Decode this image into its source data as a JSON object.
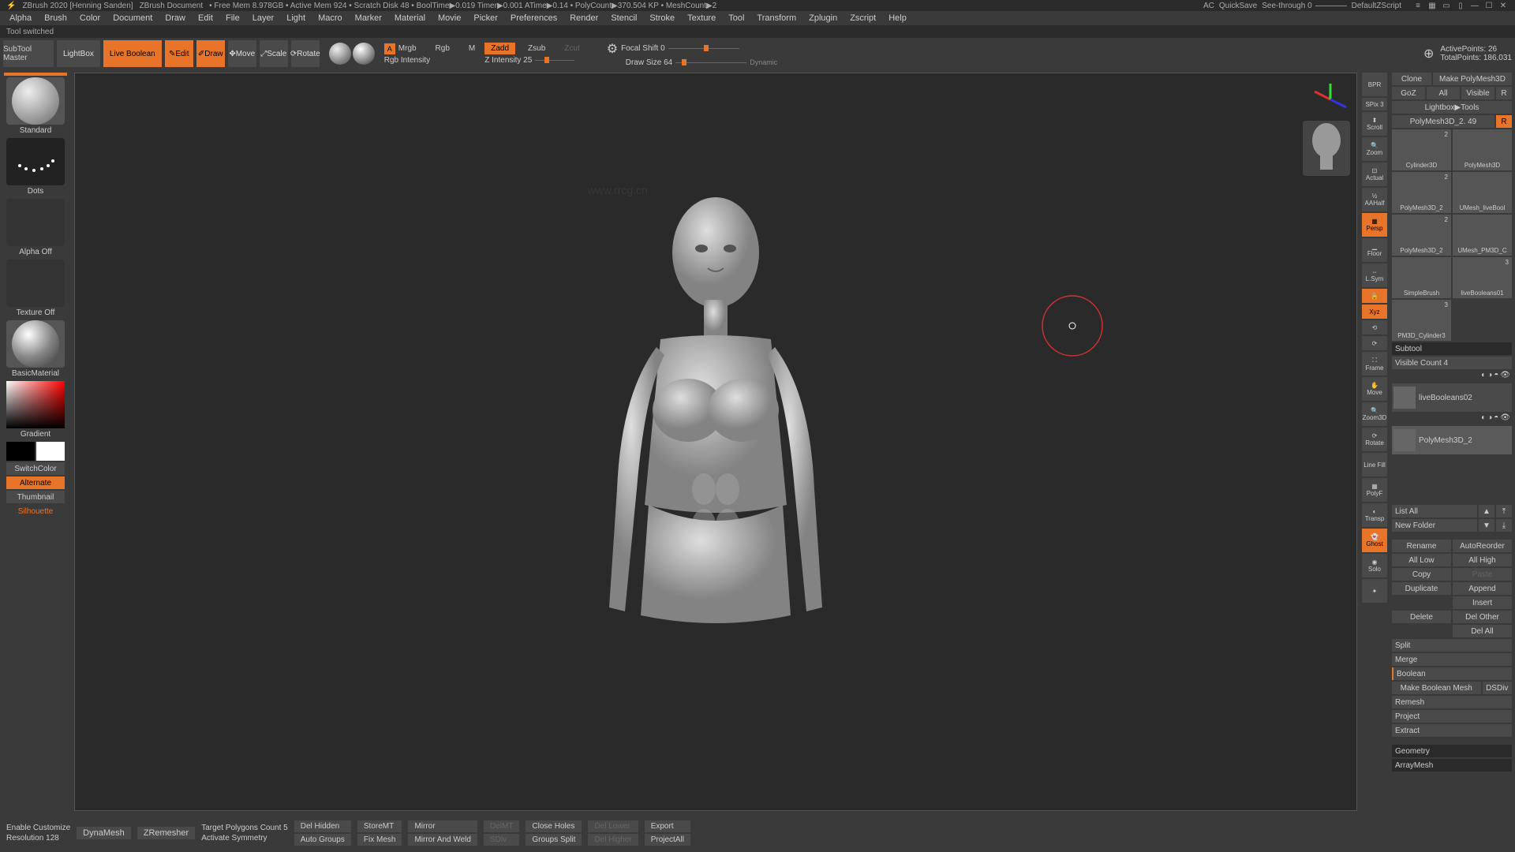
{
  "titlebar": {
    "app": "ZBrush 2020 [Henning Sanden]",
    "doc": "ZBrush Document",
    "stats": "• Free Mem 8.978GB • Active Mem 924 • Scratch Disk 48 • BoolTime▶0.019 Timer▶0.001 ATime▶0.14 • PolyCount▶370.504 KP • MeshCount▶2",
    "ac": "AC",
    "quicksave": "QuickSave",
    "seethrough": "See-through  0",
    "defaultscript": "DefaultZScript"
  },
  "menubar": [
    "Alpha",
    "Brush",
    "Color",
    "Document",
    "Draw",
    "Edit",
    "File",
    "Layer",
    "Light",
    "Macro",
    "Marker",
    "Material",
    "Movie",
    "Picker",
    "Preferences",
    "Render",
    "Stencil",
    "Stroke",
    "Texture",
    "Tool",
    "Transform",
    "Zplugin",
    "Zscript",
    "Help"
  ],
  "status": "Tool switched",
  "toolbar": {
    "subtool_master": "SubTool\nMaster",
    "lightbox": "LightBox",
    "live_boolean": "Live Boolean",
    "edit": "Edit",
    "draw": "Draw",
    "move": "Move",
    "scale": "Scale",
    "rotate": "Rotate",
    "a": "A",
    "mrgb": "Mrgb",
    "rgb": "Rgb",
    "m": "M",
    "rgb_intensity": "Rgb Intensity",
    "zadd": "Zadd",
    "zsub": "Zsub",
    "zcut": "Zcut",
    "z_intensity": "Z Intensity 25",
    "focal_shift": "Focal Shift 0",
    "draw_size": "Draw Size 64",
    "dynamic": "Dynamic",
    "active_points": "ActivePoints: 26",
    "total_points": "TotalPoints: 186,031"
  },
  "left": {
    "brush": "Standard",
    "stroke": "Dots",
    "alpha": "Alpha Off",
    "texture": "Texture Off",
    "material": "BasicMaterial",
    "gradient": "Gradient",
    "switchcolor": "SwitchColor",
    "alternate": "Alternate",
    "thumbnail": "Thumbnail",
    "silhouette": "Silhouette"
  },
  "right_tools": {
    "bpr": "BPR",
    "spix": "SPix 3",
    "scroll": "Scroll",
    "zoom": "Zoom",
    "actual": "Actual",
    "aahalf": "AAHalf",
    "persp": "Persp",
    "floor": "Floor",
    "lsym": "L.Sym",
    "lock": "",
    "xyz": "Xyz",
    "frame": "Frame",
    "move": "Move",
    "zoom3d": "Zoom3D",
    "rotate": "Rotate",
    "linefill": "Line Fill",
    "polyf": "PolyF",
    "transp": "Transp",
    "ghost": "Ghost",
    "solo": "Solo"
  },
  "rp": {
    "clone": "Clone",
    "make_polymesh": "Make PolyMesh3D",
    "goz": "GoZ",
    "all": "All",
    "visible": "Visible",
    "r": "R",
    "lightbox_tools": "Lightbox▶Tools",
    "current_tool": "PolyMesh3D_2. 49",
    "r2": "R",
    "tools": [
      {
        "name": "Cylinder3D",
        "badge": "2"
      },
      {
        "name": "PolyMesh3D"
      },
      {
        "name": "PolyMesh3D_2",
        "badge": "2"
      },
      {
        "name": "UMesh_liveBool"
      },
      {
        "name": "PolyMesh3D_2",
        "badge": "2"
      },
      {
        "name": "UMesh_PM3D_C"
      },
      {
        "name": "SimpleBrush"
      },
      {
        "name": "liveBooleans01",
        "badge": "3"
      },
      {
        "name": "PM3D_Cylinder3",
        "badge": "3"
      }
    ],
    "subtool_header": "Subtool",
    "visible_count": "Visible Count 4",
    "subtools": [
      {
        "name": "liveBooleans02"
      },
      {
        "name": "PolyMesh3D_2"
      }
    ],
    "list_all": "List All",
    "new_folder": "New Folder",
    "rename": "Rename",
    "autoreorder": "AutoReorder",
    "all_low": "All Low",
    "all_high": "All High",
    "copy": "Copy",
    "paste": "Paste",
    "duplicate": "Duplicate",
    "append": "Append",
    "insert": "Insert",
    "delete": "Delete",
    "del_other": "Del Other",
    "del_all": "Del All",
    "split": "Split",
    "merge": "Merge",
    "boolean": "Boolean",
    "make_boolean": "Make Boolean Mesh",
    "dsdiv": "DSDiv",
    "remesh": "Remesh",
    "project": "Project",
    "extract": "Extract",
    "geometry": "Geometry",
    "arraymesh": "ArrayMesh"
  },
  "bottom": {
    "enable_customize": "Enable Customize",
    "resolution": "Resolution 128",
    "dynamesh": "DynaMesh",
    "zremesher": "ZRemesher",
    "target_poly": "Target Polygons Count 5",
    "activate_sym": "Activate Symmetry",
    "del_hidden": "Del Hidden",
    "auto_groups": "Auto Groups",
    "storemt": "StoreMT",
    "fix_mesh": "Fix Mesh",
    "mirror": "Mirror",
    "mirror_weld": "Mirror And Weld",
    "delmt": "DelMT",
    "sdiv": "SDiv",
    "close_holes": "Close Holes",
    "groups_split": "Groups Split",
    "del_lower": "Del Lower",
    "del_higher": "Del Higher",
    "export": "Export",
    "project_all": "ProjectAll"
  },
  "watermark": "www.rrcg.cn"
}
